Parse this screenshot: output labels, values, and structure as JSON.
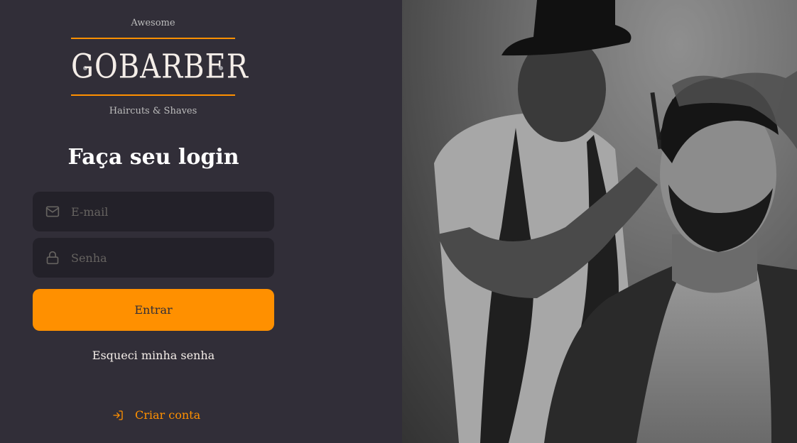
{
  "logo": {
    "top_text": "Awesome",
    "brand": "GOBARBER",
    "bottom_text": "Haircuts & Shaves"
  },
  "title": "Faça seu login",
  "form": {
    "email_placeholder": "E-mail",
    "password_placeholder": "Senha",
    "submit_label": "Entrar"
  },
  "links": {
    "forgot": "Esqueci minha senha",
    "create": "Criar conta"
  },
  "colors": {
    "accent": "#ff9000",
    "background": "#312e38",
    "input_bg": "#232129"
  },
  "icons": {
    "email": "mail-icon",
    "password": "lock-icon",
    "create": "log-in-icon"
  }
}
